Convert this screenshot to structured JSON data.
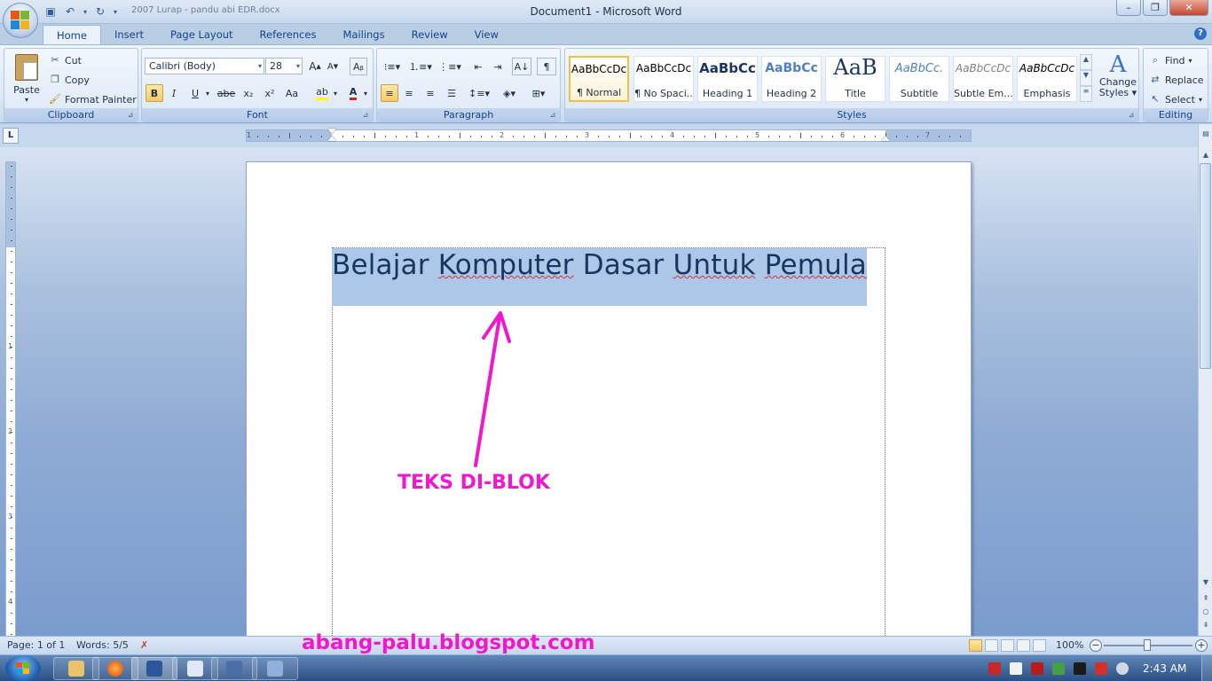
{
  "window": {
    "title": "Document1 - Microsoft Word",
    "qat_file": "2007 Lurap - pandu abi EDR.docx"
  },
  "tabs": [
    "Home",
    "Insert",
    "Page Layout",
    "References",
    "Mailings",
    "Review",
    "View"
  ],
  "ribbon": {
    "clipboard": {
      "label": "Clipboard",
      "paste": "Paste",
      "cut": "Cut",
      "copy": "Copy",
      "format_painter": "Format Painter"
    },
    "font": {
      "label": "Font",
      "font_name": "Calibri (Body)",
      "font_size": "28",
      "bold": "B",
      "italic": "I",
      "underline": "U",
      "strike": "abe",
      "subscript": "x₂",
      "superscript": "x²",
      "change_case": "Aa"
    },
    "paragraph": {
      "label": "Paragraph",
      "pilcrow": "¶"
    },
    "styles": {
      "label": "Styles",
      "items": [
        {
          "preview": "AaBbCcDc",
          "name": "¶ Normal"
        },
        {
          "preview": "AaBbCcDc",
          "name": "¶ No Spaci..."
        },
        {
          "preview": "AaBbCc",
          "name": "Heading 1"
        },
        {
          "preview": "AaBbCc",
          "name": "Heading 2"
        },
        {
          "preview": "AaB",
          "name": "Title"
        },
        {
          "preview": "AaBbCc.",
          "name": "Subtitle"
        },
        {
          "preview": "AaBbCcDc",
          "name": "Subtle Em..."
        },
        {
          "preview": "AaBbCcDc",
          "name": "Emphasis"
        }
      ],
      "change_styles": "Change Styles"
    },
    "editing": {
      "label": "Editing",
      "find": "Find",
      "replace": "Replace",
      "select": "Select"
    }
  },
  "ruler": {
    "labels": [
      "1",
      "1",
      "2",
      "3",
      "4",
      "5",
      "6",
      "7"
    ],
    "vlabels": [
      "1",
      "2",
      "3",
      "4"
    ]
  },
  "document": {
    "words": [
      "Belajar",
      "Komputer",
      "Dasar",
      "Untuk",
      "Pemula"
    ],
    "annotation": "TEKS DI-BLOK"
  },
  "status": {
    "page": "Page: 1 of 1",
    "words": "Words: 5/5",
    "watermark": "abang-palu.blogspot.com",
    "zoom": "100%"
  },
  "taskbar": {
    "clock": "2:43 AM"
  },
  "colors": {
    "accent": "#f217cf",
    "selection": "#adc7e8",
    "doc_text": "#17365d"
  }
}
